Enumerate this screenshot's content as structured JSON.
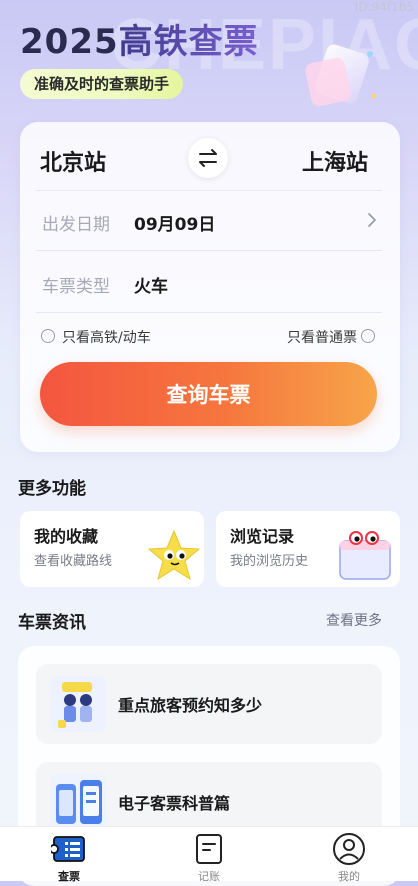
{
  "header": {
    "watermark_id": "ID:94f1b5",
    "bg_letters": "CHEPIAO",
    "title_year": "2025",
    "title_text": "高铁查票",
    "subtitle": "准确及时的查票助手"
  },
  "search": {
    "from_station": "北京站",
    "to_station": "上海站",
    "date_label": "出发日期",
    "date_value": "09月09日",
    "type_label": "车票类型",
    "type_value": "火车",
    "option_left": "只看高铁/动车",
    "option_right": "只看普通票",
    "query_button": "查询车票"
  },
  "more": {
    "title": "更多功能",
    "cards": [
      {
        "title": "我的收藏",
        "subtitle": "查看收藏路线",
        "icon": "star-mascot-icon"
      },
      {
        "title": "浏览记录",
        "subtitle": "我的浏览历史",
        "icon": "calendar-mascot-icon"
      }
    ]
  },
  "news": {
    "title": "车票资讯",
    "see_more": "查看更多",
    "items": [
      {
        "title": "重点旅客预约知多少",
        "icon": "travelers-illustration-icon"
      },
      {
        "title": "电子客票科普篇",
        "icon": "phone-ticket-illustration-icon"
      }
    ]
  },
  "tabbar": {
    "items": [
      {
        "label": "查票",
        "icon": "ticket-icon",
        "active": true
      },
      {
        "label": "记账",
        "icon": "ledger-icon",
        "active": false
      },
      {
        "label": "我的",
        "icon": "profile-icon",
        "active": false
      }
    ]
  },
  "colors": {
    "accent_start": "#f4563f",
    "accent_end": "#f7a54a",
    "title": "#2b2b52"
  }
}
